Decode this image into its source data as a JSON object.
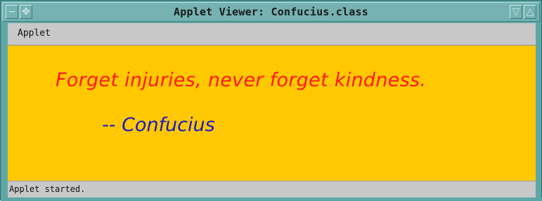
{
  "window": {
    "title": "Applet Viewer: Confucius.class",
    "frame_color": "#5fa7a7",
    "controls": {
      "menu_icon": "window-menu-icon",
      "move_icon": "move-icon",
      "minimize_icon": "minimize-icon",
      "maximize_icon": "maximize-icon"
    }
  },
  "menubar": {
    "items": [
      {
        "label": "Applet"
      }
    ]
  },
  "applet": {
    "background": "#ffc800",
    "quote": "Forget injuries, never forget kindness.",
    "quote_color": "#ff1a1a",
    "author": "-- Confucius",
    "author_color": "#1a1ac8"
  },
  "statusbar": {
    "text": "Applet started."
  }
}
